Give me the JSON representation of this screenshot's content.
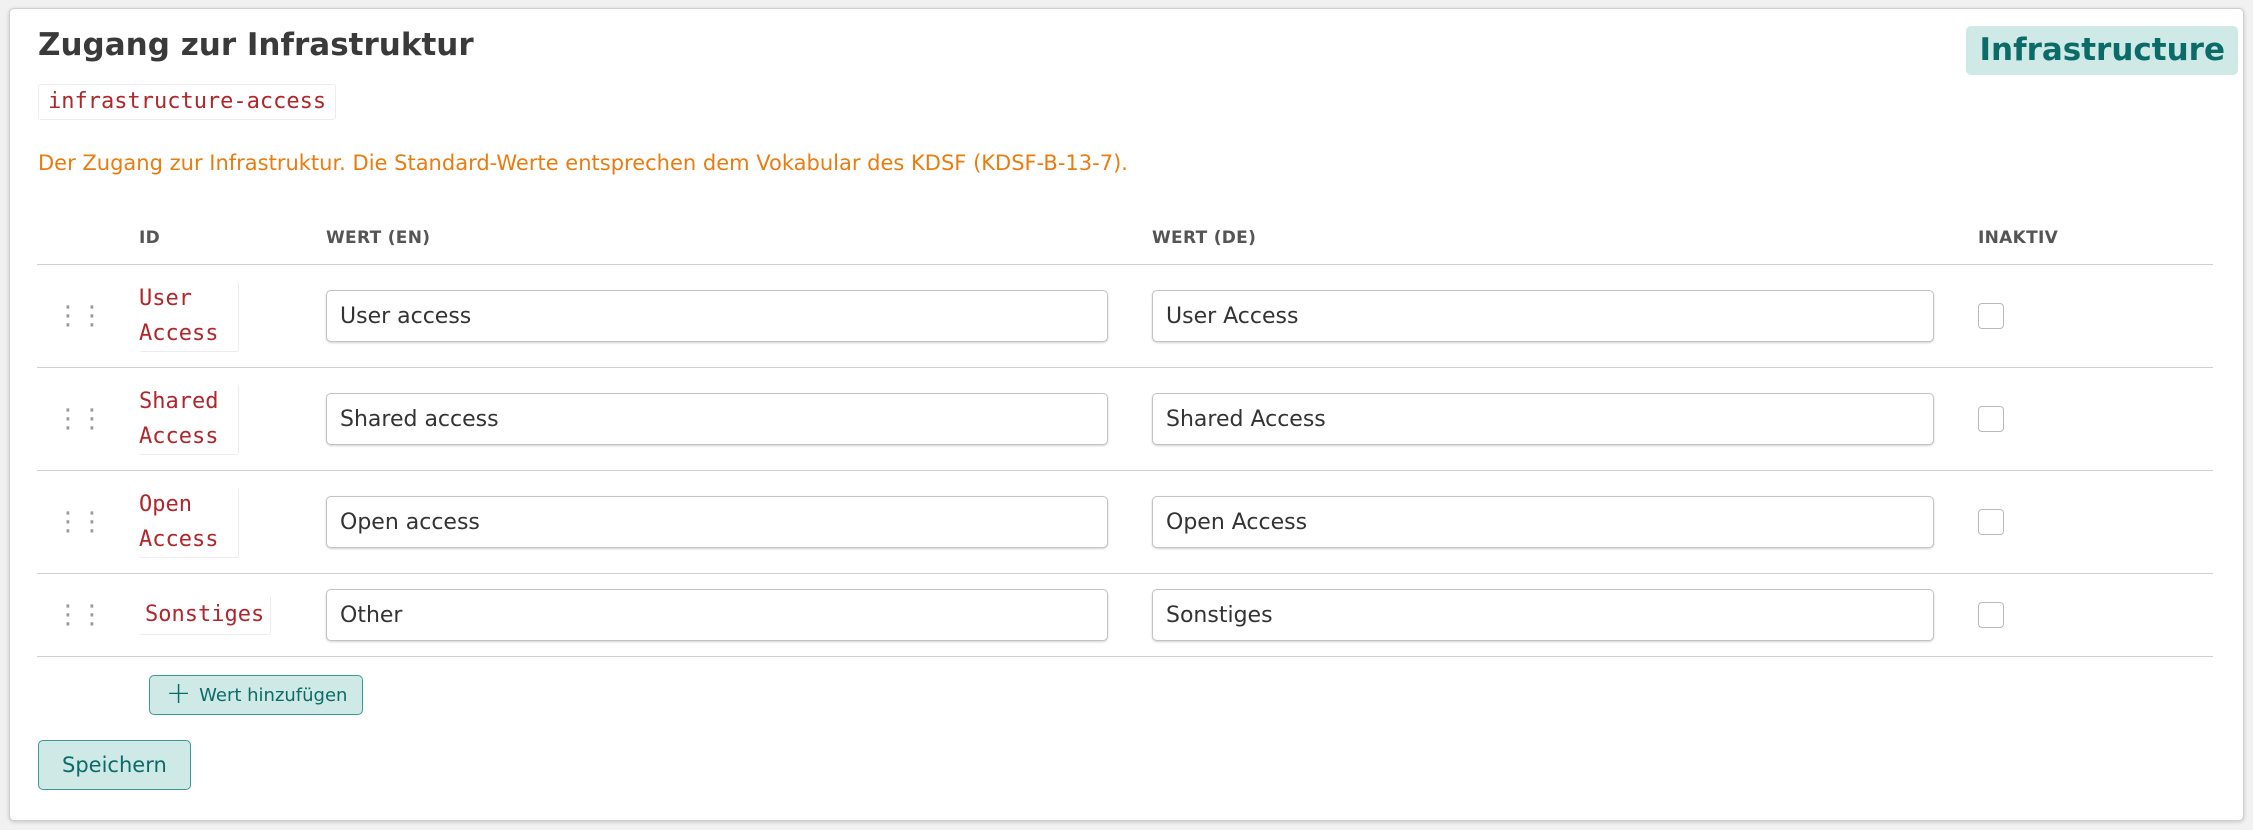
{
  "section": {
    "title": "Zugang zur Infrastruktur",
    "key": "infrastructure-access",
    "badge": "Infrastructure",
    "description": "Der Zugang zur Infrastruktur. Die Standard-Werte entsprechen dem Vokabular des KDSF (KDSF-B-13-7)."
  },
  "table": {
    "headers": {
      "id": "ID",
      "value_en": "WERT (EN)",
      "value_de": "WERT (DE)",
      "inactive": "INAKTIV"
    },
    "rows": [
      {
        "id": "User Access",
        "value_en": "User access",
        "value_de": "User Access",
        "inactive": false
      },
      {
        "id": "Shared Access",
        "value_en": "Shared access",
        "value_de": "Shared Access",
        "inactive": false
      },
      {
        "id": "Open Access",
        "value_en": "Open access",
        "value_de": "Open Access",
        "inactive": false
      },
      {
        "id": "Sonstiges",
        "value_en": "Other",
        "value_de": "Sonstiges",
        "inactive": false
      }
    ]
  },
  "actions": {
    "add_value_label": "Wert hinzufügen",
    "save_label": "Speichern"
  },
  "icons": {
    "drag_handle": "drag-handle-icon",
    "add": "plus-icon"
  },
  "colors": {
    "accent": "#0b6b68",
    "accent_bg": "#cfe9e7",
    "description": "#e97c0e",
    "code": "#b0262b"
  }
}
